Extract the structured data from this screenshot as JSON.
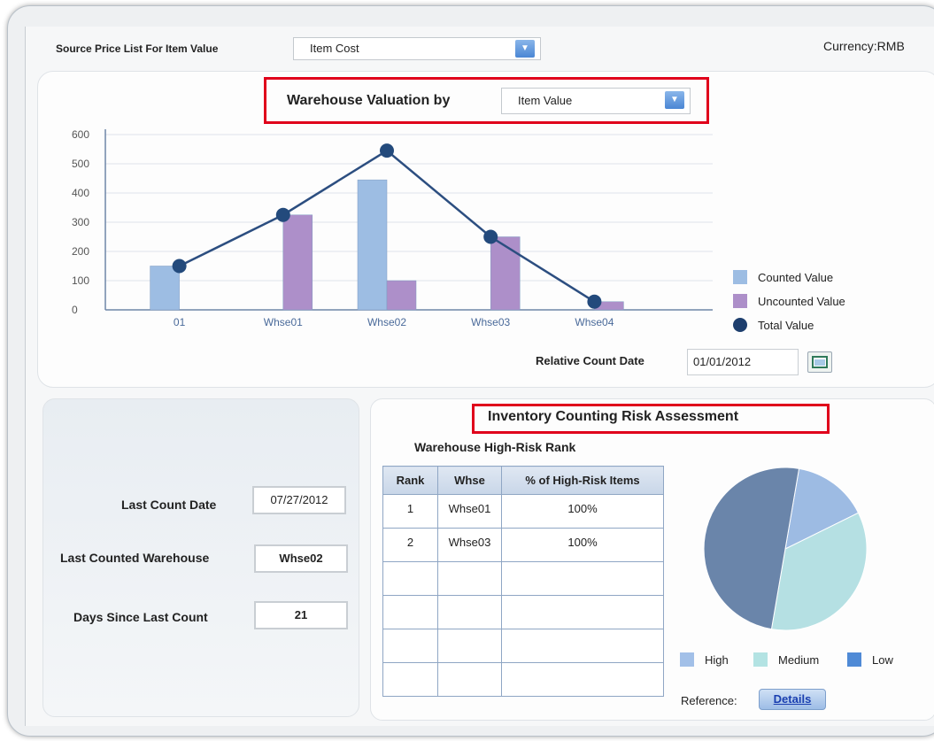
{
  "header": {
    "source_label": "Source Price List For Item Value",
    "source_value": "Item Cost",
    "currency": "Currency:RMB"
  },
  "valuation": {
    "title": "Warehouse Valuation by",
    "select_value": "Item Value",
    "relative_label": "Relative Count Date",
    "relative_value": "01/01/2012"
  },
  "chart_data": {
    "type": "bar",
    "categories": [
      "01",
      "Whse01",
      "Whse02",
      "Whse03",
      "Whse04"
    ],
    "ylim": [
      0,
      600
    ],
    "yticks": [
      0,
      100,
      200,
      300,
      400,
      500,
      600
    ],
    "series": [
      {
        "name": "Counted Value",
        "type": "bar",
        "color": "#9dbde3",
        "values": [
          150,
          0,
          445,
          0,
          0
        ]
      },
      {
        "name": "Uncounted Value",
        "type": "bar",
        "color": "#ad8fc9",
        "values": [
          0,
          325,
          100,
          250,
          28
        ]
      },
      {
        "name": "Total Value",
        "type": "line",
        "color": "#2c4e80",
        "values": [
          150,
          325,
          545,
          250,
          28
        ]
      }
    ],
    "legend": "right",
    "grid": true
  },
  "last_count": {
    "date_label": "Last Count Date",
    "date_value": "07/27/2012",
    "warehouse_label": "Last Counted Warehouse",
    "warehouse_value": "Whse02",
    "days_label": "Days Since Last Count",
    "days_value": "21"
  },
  "risk": {
    "title": "Inventory Counting Risk Assessment",
    "subtitle": "Warehouse High-Risk Rank",
    "columns": [
      "Rank",
      "Whse",
      "% of High-Risk Items"
    ],
    "rows": [
      [
        "1",
        "Whse01",
        "100%"
      ],
      [
        "2",
        "Whse03",
        "100%"
      ],
      [
        "",
        "",
        ""
      ],
      [
        "",
        "",
        ""
      ],
      [
        "",
        "",
        ""
      ],
      [
        "",
        "",
        ""
      ]
    ],
    "pie": [
      {
        "name": "High",
        "value": 15,
        "color": "#9dbbe3"
      },
      {
        "name": "Medium",
        "value": 35,
        "color": "#b5e0e3"
      },
      {
        "name": "Low",
        "value": 50,
        "color": "#6a85aa"
      }
    ],
    "legend_colors": {
      "high": "#a2c0e8",
      "medium": "#b3e3e3",
      "low": "#4f8ad6"
    },
    "reference_label": "Reference:",
    "details_label": "Details"
  }
}
